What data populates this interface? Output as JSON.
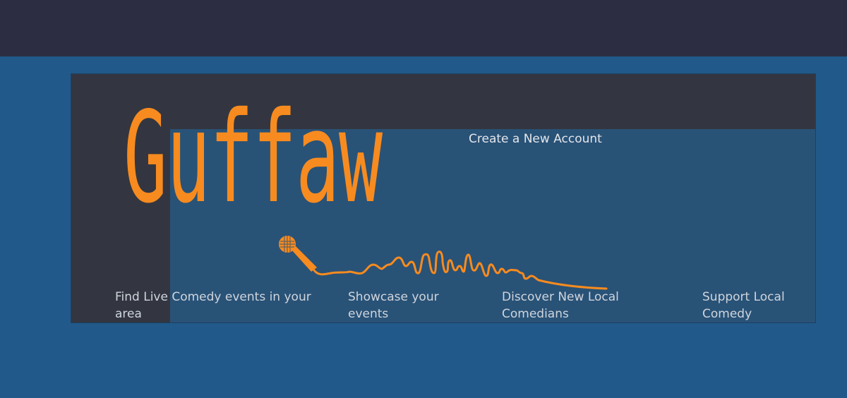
{
  "header": {
    "background_color": "#2c2d42"
  },
  "hero": {
    "logo_text": "Guffaw",
    "logo_color": "#f78b1f",
    "create_account_label": "Create a New Account",
    "features": [
      {
        "label": "Find Live Comedy events in your area"
      },
      {
        "label": "Showcase your events"
      },
      {
        "label": "Discover New Local Comedians"
      },
      {
        "label": "Support Local Comedy"
      }
    ],
    "icons": [
      "microphone-icon",
      "sound-wave-icon"
    ]
  },
  "colors": {
    "page_background": "#215a8a",
    "hero_dark": "#333640",
    "hero_overlay": "#295277",
    "accent": "#f78b1f"
  }
}
